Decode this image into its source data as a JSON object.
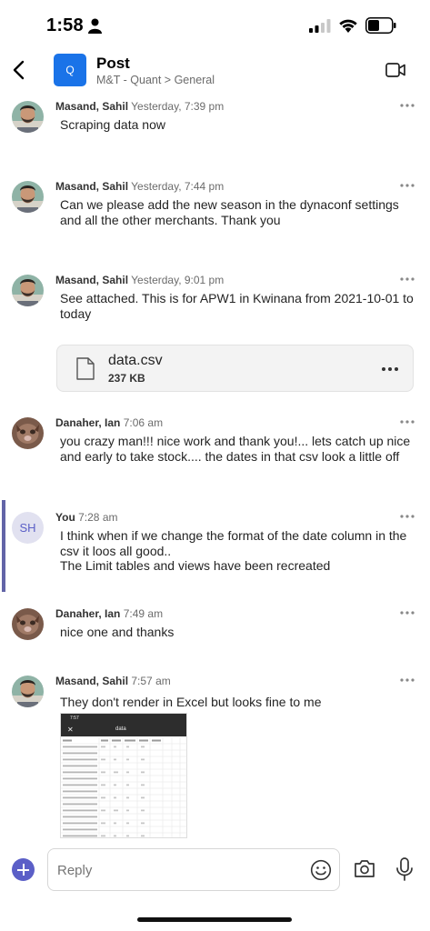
{
  "status_bar": {
    "time": "1:58"
  },
  "header": {
    "channel_initial": "Q",
    "title": "Post",
    "subtitle": "M&T - Quant > General"
  },
  "messages": [
    {
      "author": "Masand, Sahil",
      "time": "Yesterday, 7:39 pm",
      "lines": [
        "Scraping data now"
      ]
    },
    {
      "author": "Masand, Sahil",
      "time": "Yesterday, 7:44 pm",
      "lines": [
        "Can we please add the new season in the dynaconf settings",
        "and all the other merchants. Thank you"
      ]
    },
    {
      "author": "Masand, Sahil",
      "time": "Yesterday, 9:01 pm",
      "lines": [
        "See attached. This is for APW1 in Kwinana from 2021-10-01 to",
        "today"
      ]
    },
    {
      "author": "Danaher, Ian",
      "time": "7:06 am",
      "lines": [
        "you crazy man!!! nice work and thank you!... lets catch up nice",
        "and early to take stock.... the dates in that csv look a little off"
      ]
    },
    {
      "author": "You",
      "time": "7:28 am",
      "initials": "SH",
      "lines": [
        "I think when if we change the format of the date column in the",
        "csv it loos all good..",
        "The Limit tables and views have been recreated"
      ]
    },
    {
      "author": "Danaher, Ian",
      "time": "7:49 am",
      "lines": [
        "nice one and thanks"
      ]
    },
    {
      "author": "Masand, Sahil",
      "time": "7:57 am",
      "lines": [
        "They don't render in Excel but looks fine to me"
      ]
    }
  ],
  "attachment": {
    "name": "data.csv",
    "size": "237 KB"
  },
  "image_preview": {
    "status_time": "7:57",
    "title": "data"
  },
  "compose": {
    "placeholder": "Reply"
  },
  "colors": {
    "accent": "#5b5fc7",
    "you_bar": "#6264a7",
    "channel": "#1a73e8"
  }
}
